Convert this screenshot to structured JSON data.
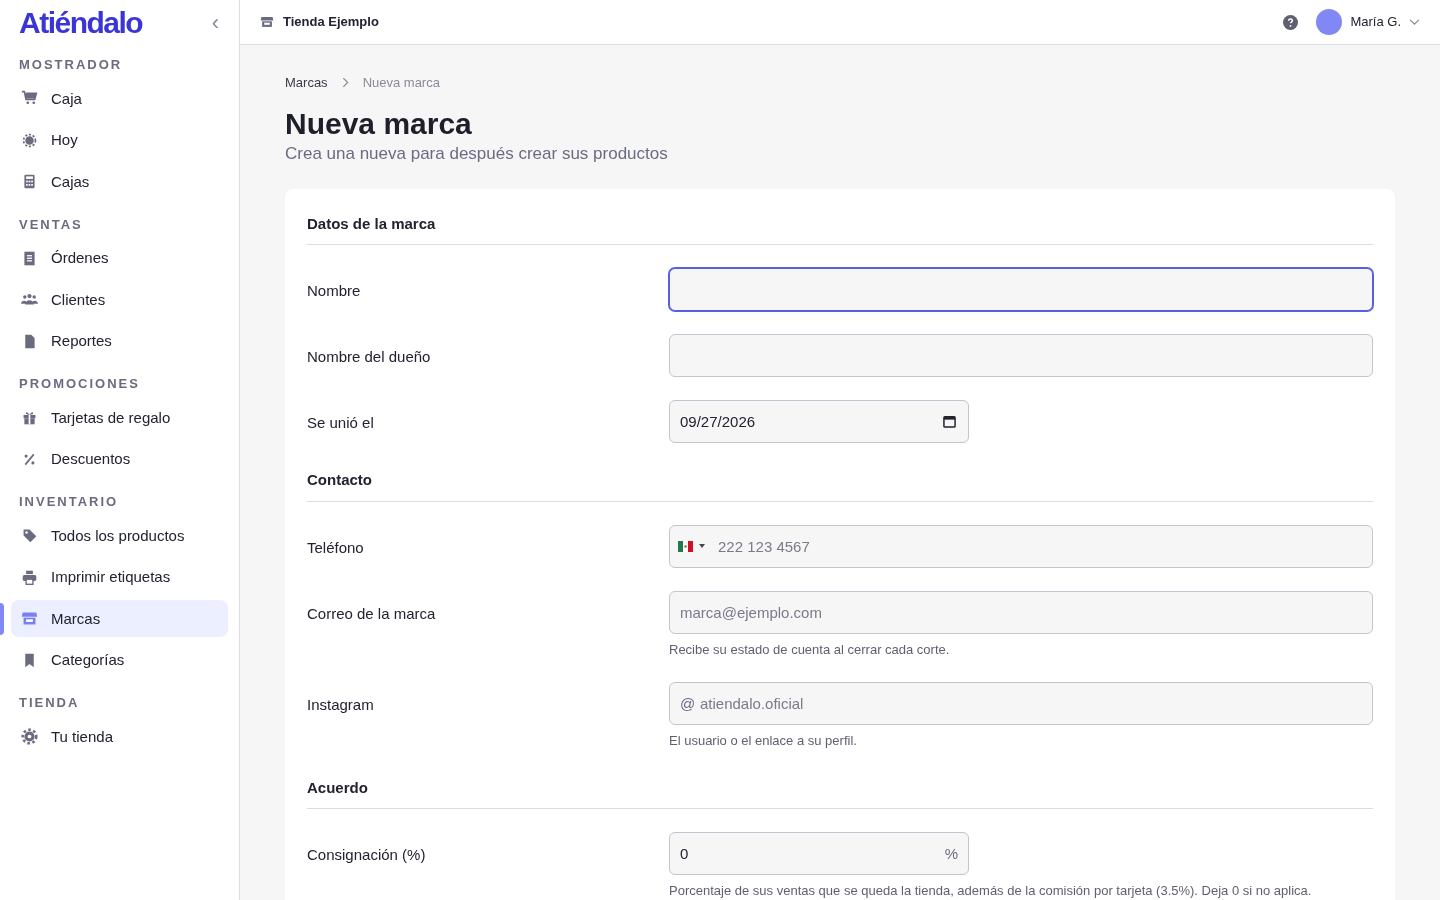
{
  "sidebar": {
    "logo": "Atiéndalo",
    "collapse_icon": "‹",
    "sections": [
      {
        "title": "MOSTRADOR",
        "items": [
          {
            "label": "Caja",
            "selected": false
          },
          {
            "label": "Hoy",
            "selected": false
          },
          {
            "label": "Cajas",
            "selected": false
          }
        ]
      },
      {
        "title": "VENTAS",
        "items": [
          {
            "label": "Órdenes",
            "selected": false
          },
          {
            "label": "Clientes",
            "selected": false
          },
          {
            "label": "Reportes",
            "selected": false
          }
        ]
      },
      {
        "title": "PROMOCIONES",
        "items": [
          {
            "label": "Tarjetas de regalo",
            "selected": false
          },
          {
            "label": "Descuentos",
            "selected": false
          }
        ]
      },
      {
        "title": "INVENTARIO",
        "items": [
          {
            "label": "Todos los productos",
            "selected": false
          },
          {
            "label": "Imprimir etiquetas",
            "selected": false
          },
          {
            "label": "Marcas",
            "selected": true
          },
          {
            "label": "Categorías",
            "selected": false
          }
        ]
      },
      {
        "title": "TIENDA",
        "items": [
          {
            "label": "Tu tienda",
            "selected": false
          }
        ]
      }
    ]
  },
  "header": {
    "store": "Tienda Ejemplo",
    "user": "María G."
  },
  "breadcrumb": [
    {
      "label": "Marcas"
    },
    {
      "label": "Nueva marca"
    }
  ],
  "page": {
    "title": "Nueva marca",
    "subtitle": "Crea una nueva para después crear sus productos"
  },
  "form": {
    "sections": [
      {
        "title": "Datos de la marca",
        "fields": [
          {
            "label": "Nombre",
            "kind": "text",
            "focused": true
          },
          {
            "label": "Nombre del dueño",
            "kind": "text",
            "focused": false
          },
          {
            "label": "Se unió el",
            "kind": "date",
            "value": "09/27/2026",
            "focused": false
          }
        ]
      },
      {
        "title": "Contacto",
        "fields": [
          {
            "label": "Teléfono",
            "kind": "phone",
            "placeholder": "222 123 4567",
            "focused": false
          },
          {
            "label": "Correo de la marca",
            "kind": "text",
            "placeholder": "marca@ejemplo.com",
            "help": "Recibe su estado de cuenta al cerrar cada corte.",
            "focused": false
          },
          {
            "label": "Instagram",
            "kind": "handle",
            "prefix": "@",
            "placeholder": "atiendalo.oficial",
            "help": "El usuario o el enlace a su perfil.",
            "focused": false
          }
        ]
      },
      {
        "title": "Acuerdo",
        "fields": [
          {
            "label": "Consignación (%)",
            "kind": "percent",
            "value": "0",
            "suffix": "%",
            "help": "Porcentaje de sus ventas que se queda la tienda, además de la comisión por tarjeta (3.5%). Deja 0 si no aplica.",
            "focused": false
          }
        ]
      }
    ]
  }
}
